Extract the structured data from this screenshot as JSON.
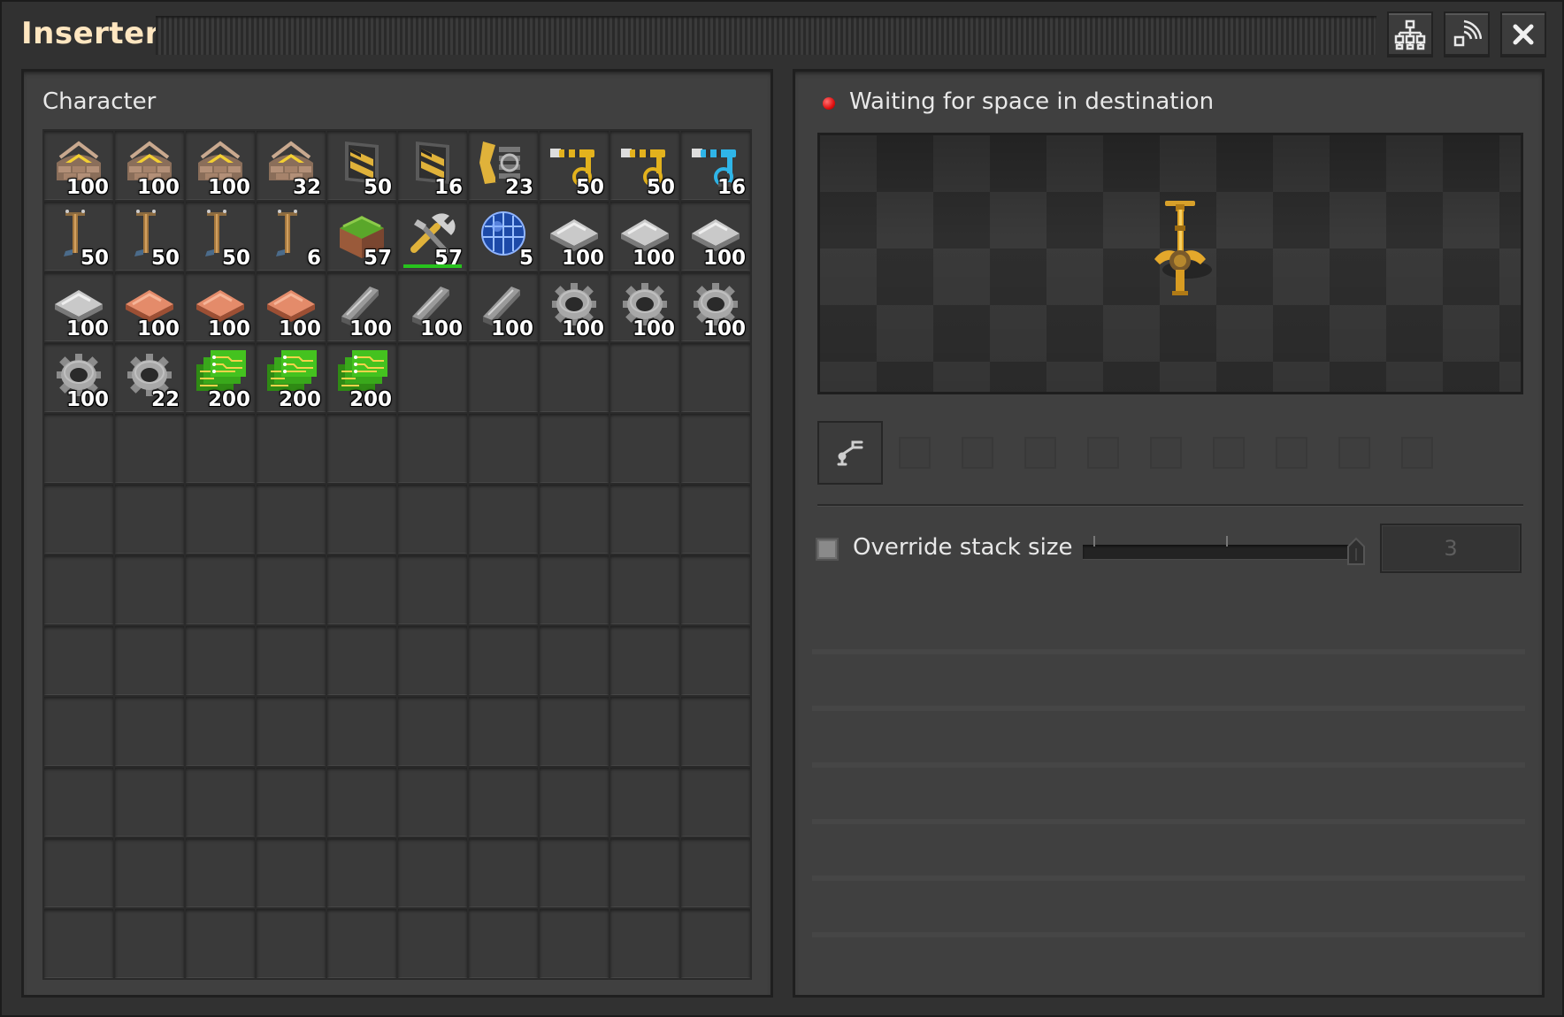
{
  "window": {
    "title": "Inserter",
    "buttons": [
      "circuit-network-icon",
      "signal-icon",
      "close-icon"
    ]
  },
  "left_panel": {
    "title": "Character",
    "slots": [
      {
        "icon": "stone-wall-icon",
        "count": "100"
      },
      {
        "icon": "stone-wall-icon",
        "count": "100"
      },
      {
        "icon": "stone-wall-icon",
        "count": "100"
      },
      {
        "icon": "stone-wall-icon",
        "count": "32"
      },
      {
        "icon": "gate-icon",
        "count": "50"
      },
      {
        "icon": "gate-icon",
        "count": "16"
      },
      {
        "icon": "radar-icon",
        "count": "23"
      },
      {
        "icon": "inserter-icon",
        "count": "50",
        "color": "#e3b21d"
      },
      {
        "icon": "inserter-icon",
        "count": "50",
        "color": "#e3b21d"
      },
      {
        "icon": "fast-inserter-icon",
        "count": "16",
        "color": "#2fb5e8"
      },
      {
        "icon": "small-electric-pole-icon",
        "count": "50"
      },
      {
        "icon": "small-electric-pole-icon",
        "count": "50"
      },
      {
        "icon": "small-electric-pole-icon",
        "count": "50"
      },
      {
        "icon": "small-electric-pole-icon",
        "count": "6"
      },
      {
        "icon": "landfill-icon",
        "count": "57"
      },
      {
        "icon": "repair-pack-icon",
        "count": "57",
        "durability": 1
      },
      {
        "icon": "science-pack-icon",
        "count": "5"
      },
      {
        "icon": "iron-plate-icon",
        "count": "100"
      },
      {
        "icon": "iron-plate-icon",
        "count": "100"
      },
      {
        "icon": "iron-plate-icon",
        "count": "100"
      },
      {
        "icon": "iron-plate-icon",
        "count": "100"
      },
      {
        "icon": "copper-plate-icon",
        "count": "100"
      },
      {
        "icon": "copper-plate-icon",
        "count": "100"
      },
      {
        "icon": "copper-plate-icon",
        "count": "100"
      },
      {
        "icon": "steel-plate-icon",
        "count": "100"
      },
      {
        "icon": "steel-plate-icon",
        "count": "100"
      },
      {
        "icon": "steel-plate-icon",
        "count": "100"
      },
      {
        "icon": "iron-gear-icon",
        "count": "100"
      },
      {
        "icon": "iron-gear-icon",
        "count": "100"
      },
      {
        "icon": "iron-gear-icon",
        "count": "100"
      },
      {
        "icon": "iron-gear-icon",
        "count": "100"
      },
      {
        "icon": "iron-gear-icon",
        "count": "22"
      },
      {
        "icon": "electronic-circuit-icon",
        "count": "200"
      },
      {
        "icon": "electronic-circuit-icon",
        "count": "200"
      },
      {
        "icon": "electronic-circuit-icon",
        "count": "200"
      }
    ],
    "total_slots": 120
  },
  "right_panel": {
    "status_text": "Waiting for space in destination",
    "status_color": "#e01010",
    "preview_entity": "inserter-icon",
    "mode_icon": "inserter-config-icon",
    "override_label": "Override stack size",
    "override_checked": false,
    "stack_size_value": "3",
    "slider_value": 3,
    "slider_max": 3
  }
}
